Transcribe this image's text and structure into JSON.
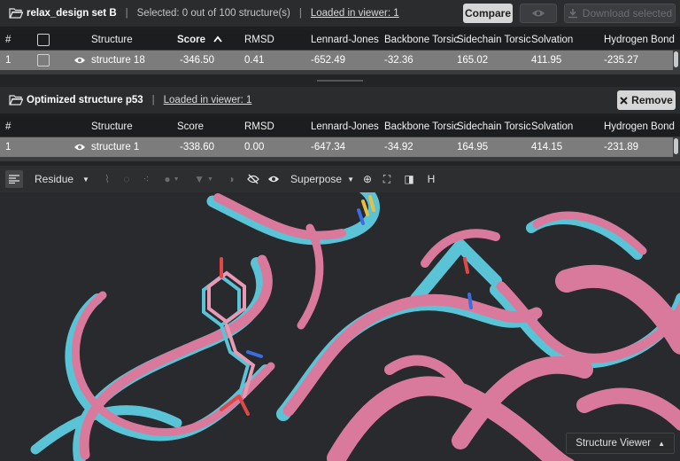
{
  "set_panel": {
    "title": "relax_design set B",
    "selected_text": "Selected: 0 out of 100 structure(s)",
    "loaded_text": "Loaded in viewer: 1",
    "compare_label": "Compare",
    "download_label": "Download selected"
  },
  "set_table": {
    "headers": [
      "#",
      "Structure",
      "Score",
      "RMSD",
      "Lennard-Jones",
      "Backbone Torsic",
      "Sidechain Torsic",
      "Solvation",
      "Hydrogen Bond"
    ],
    "row": {
      "index": "1",
      "structure": "structure 18",
      "score": "-346.50",
      "rmsd": "0.41",
      "lj": "-652.49",
      "bb": "-32.36",
      "sc": "165.02",
      "solv": "411.95",
      "hb": "-235.27"
    }
  },
  "opt_panel": {
    "title": "Optimized structure p53",
    "loaded_text": "Loaded in viewer: 1",
    "remove_label": "Remove"
  },
  "opt_table": {
    "headers": [
      "#",
      "Structure",
      "Score",
      "RMSD",
      "Lennard-Jones",
      "Backbone Torsic",
      "Sidechain Torsic",
      "Solvation",
      "Hydrogen Bond"
    ],
    "row": {
      "index": "1",
      "structure": "structure 1",
      "score": "-338.60",
      "rmsd": "0.00",
      "lj": "-647.34",
      "bb": "-34.92",
      "sc": "164.95",
      "solv": "414.15",
      "hb": "-231.89"
    }
  },
  "toolbar": {
    "residue_label": "Residue",
    "superpose_label": "Superpose",
    "h_label": "H"
  },
  "viewer": {
    "structure_viewer_label": "Structure Viewer",
    "colors": {
      "pink": "#d97a9c",
      "cyan": "#5bc3d6",
      "bg": "#282a2d"
    }
  }
}
